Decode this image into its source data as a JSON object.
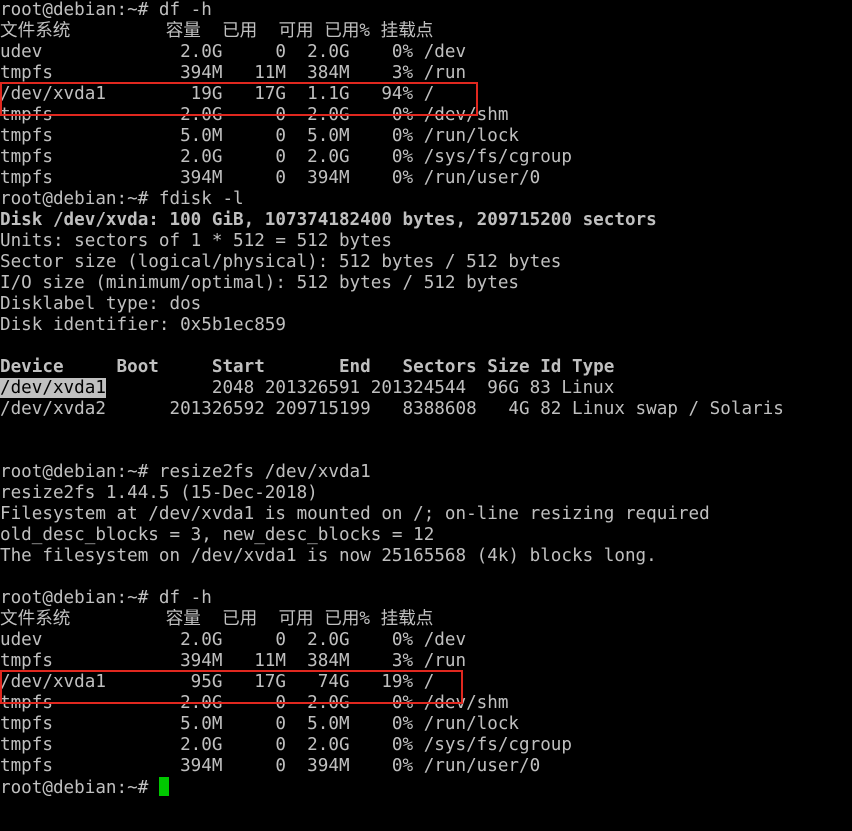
{
  "terminal": {
    "lines": [
      "root@debian:~# df -h",
      "文件系统         容量  已用  可用 已用% 挂载点",
      "udev             2.0G     0  2.0G    0% /dev",
      "tmpfs            394M   11M  384M    3% /run",
      "/dev/xvda1        19G   17G  1.1G   94% /",
      "tmpfs            2.0G     0  2.0G    0% /dev/shm",
      "tmpfs            5.0M     0  5.0M    0% /run/lock",
      "tmpfs            2.0G     0  2.0G    0% /sys/fs/cgroup",
      "tmpfs            394M     0  394M    0% /run/user/0",
      "root@debian:~# fdisk -l",
      "Disk /dev/xvda: 100 GiB, 107374182400 bytes, 209715200 sectors",
      "Units: sectors of 1 * 512 = 512 bytes",
      "Sector size (logical/physical): 512 bytes / 512 bytes",
      "I/O size (minimum/optimal): 512 bytes / 512 bytes",
      "Disklabel type: dos",
      "Disk identifier: 0x5b1ec859",
      "",
      "Device     Boot     Start       End   Sectors Size Id Type",
      "/dev/xvda1          2048 201326591 201324544  96G 83 Linux",
      "/dev/xvda2      201326592 209715199   8388608   4G 82 Linux swap / Solaris",
      "",
      "",
      "root@debian:~# resize2fs /dev/xvda1",
      "resize2fs 1.44.5 (15-Dec-2018)",
      "Filesystem at /dev/xvda1 is mounted on /; on-line resizing required",
      "old_desc_blocks = 3, new_desc_blocks = 12",
      "The filesystem on /dev/xvda1 is now 25165568 (4k) blocks long.",
      "",
      "root@debian:~# df -h",
      "文件系统         容量  已用  可用 已用% 挂载点",
      "udev             2.0G     0  2.0G    0% /dev",
      "tmpfs            394M   11M  384M    3% /run",
      "/dev/xvda1        95G   17G   74G   19% /",
      "tmpfs            2.0G     0  2.0G    0% /dev/shm",
      "tmpfs            5.0M     0  5.0M    0% /run/lock",
      "tmpfs            2.0G     0  2.0G    0% /sys/fs/cgroup",
      "tmpfs            394M     0  394M    0% /run/user/0"
    ],
    "selected_text": "/dev/xvda1",
    "selected_rest": "          2048 201326591 201324544  96G 83 Linux",
    "prompt": "root@debian:~# "
  },
  "colors": {
    "background": "#000000",
    "foreground": "#c0c0c0",
    "cursor": "#00c800",
    "annotation_box": "#e0281f"
  }
}
